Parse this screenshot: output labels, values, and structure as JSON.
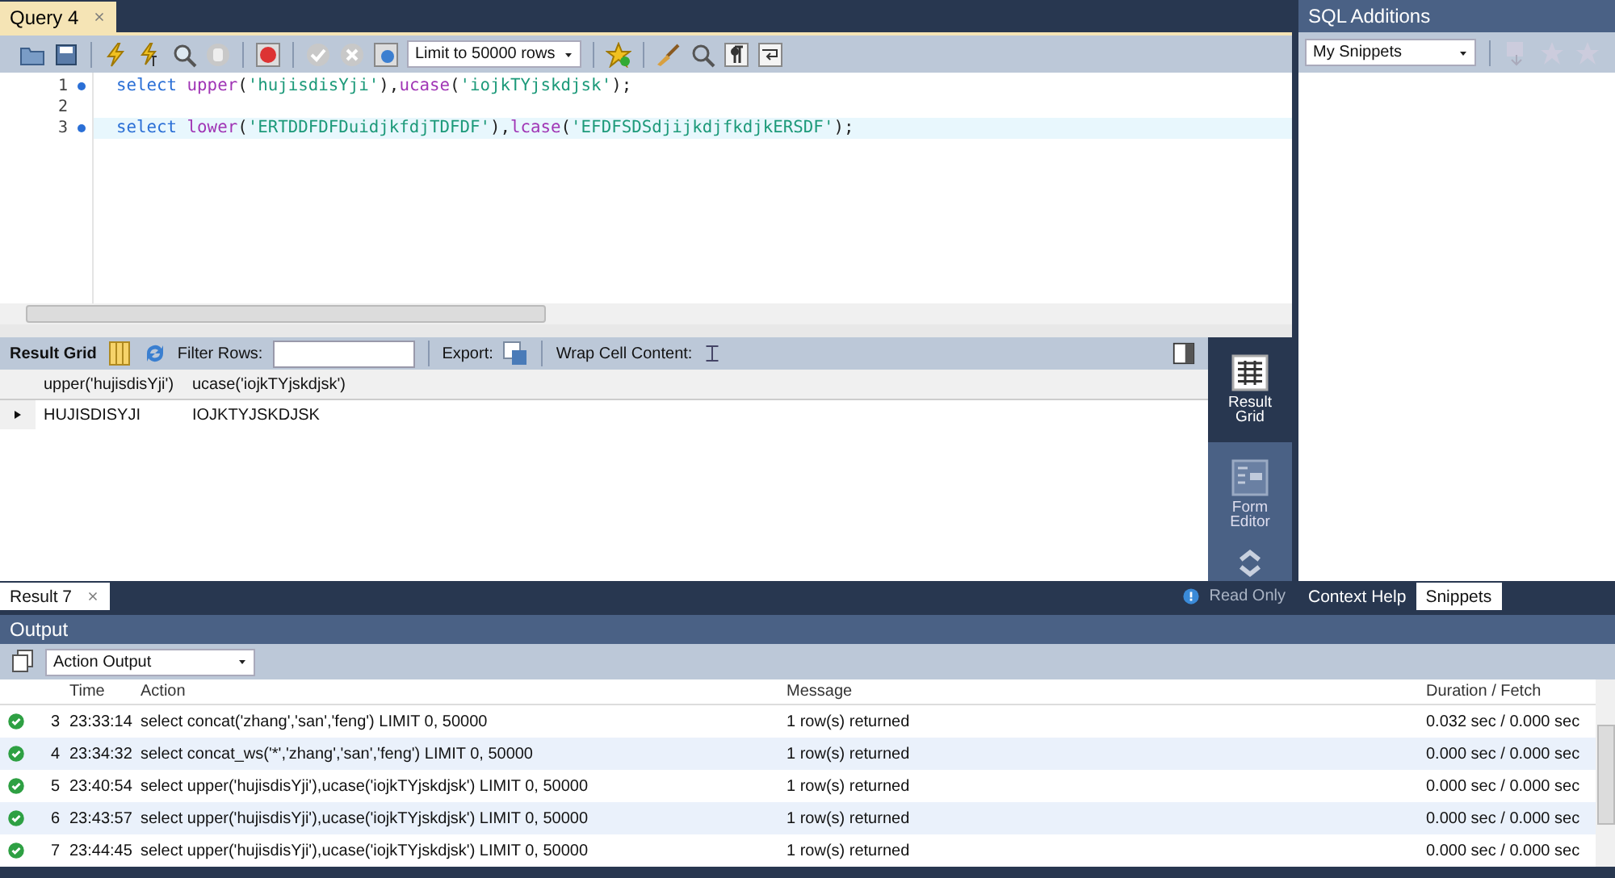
{
  "query_tab": {
    "label": "Query 4",
    "selected": true
  },
  "toolbar": {
    "limit": "Limit to 50000 rows"
  },
  "editor": {
    "lines": [
      {
        "number": "1",
        "marker": true,
        "current": false,
        "tokens": [
          {
            "kind": "keyword",
            "text": "select "
          },
          {
            "kind": "function",
            "text": "upper"
          },
          {
            "kind": "plain",
            "text": "("
          },
          {
            "kind": "string",
            "text": "'hujisdisYji'"
          },
          {
            "kind": "plain",
            "text": "),"
          },
          {
            "kind": "function",
            "text": "ucase"
          },
          {
            "kind": "plain",
            "text": "("
          },
          {
            "kind": "string",
            "text": "'iojkTYjskdjsk'"
          },
          {
            "kind": "plain",
            "text": ");"
          }
        ]
      },
      {
        "number": "2",
        "marker": false,
        "current": false
      },
      {
        "number": "3",
        "marker": true,
        "current": true,
        "tokens": [
          {
            "kind": "keyword",
            "text": "select "
          },
          {
            "kind": "function",
            "text": "lower"
          },
          {
            "kind": "plain",
            "text": "("
          },
          {
            "kind": "string",
            "text": "'ERTDDFDFDuidjkfdjTDFDF'"
          },
          {
            "kind": "plain",
            "text": "),"
          },
          {
            "kind": "function",
            "text": "lcase"
          },
          {
            "kind": "plain",
            "text": "("
          },
          {
            "kind": "string",
            "text": "'EFDFSDSdjijkdjfkdjkERSDF'"
          },
          {
            "kind": "plain",
            "text": ");"
          }
        ]
      }
    ]
  },
  "result_toolbar": {
    "result_grid": "Result Grid",
    "filter_label": "Filter Rows:",
    "export_label": "Export:",
    "wrap_label": "Wrap Cell Content:"
  },
  "grid": {
    "columns": [
      "upper('hujisdisYji')",
      "ucase('iojkTYjskdjsk')"
    ],
    "rows": [
      {
        "current": true,
        "cells": [
          "HUJISDISYJI",
          "IOJKTYJSKDJSK"
        ]
      }
    ]
  },
  "side_panel": [
    {
      "label": "Result Grid",
      "kind": "grid",
      "selected": true
    },
    {
      "label": "Form Editor",
      "kind": "form",
      "selected": false
    }
  ],
  "result_tabs": [
    {
      "label": "Result 7",
      "selected": true
    }
  ],
  "status": {
    "read_only": "Read Only"
  },
  "additions": {
    "title": "SQL Additions",
    "snippets_select": "My Snippets",
    "tabs": [
      {
        "label": "Context Help",
        "selected": false
      },
      {
        "label": "Snippets",
        "selected": true
      }
    ]
  },
  "output": {
    "title": "Output",
    "select": "Action Output",
    "columns": [
      "Time",
      "Action",
      "Message",
      "Duration / Fetch"
    ],
    "rows": [
      {
        "index": "3",
        "time": "23:33:14",
        "action": "select concat('zhang','san','feng') LIMIT 0, 50000",
        "message": "1 row(s) returned",
        "duration": "0.032 sec / 0.000 sec"
      },
      {
        "index": "4",
        "time": "23:34:32",
        "action": "select concat_ws('*','zhang','san','feng') LIMIT 0, 50000",
        "message": "1 row(s) returned",
        "duration": "0.000 sec / 0.000 sec"
      },
      {
        "index": "5",
        "time": "23:40:54",
        "action": "select upper('hujisdisYji'),ucase('iojkTYjskdjsk') LIMIT 0, 50000",
        "message": "1 row(s) returned",
        "duration": "0.000 sec / 0.000 sec"
      },
      {
        "index": "6",
        "time": "23:43:57",
        "action": "select upper('hujisdisYji'),ucase('iojkTYjskdjsk') LIMIT 0, 50000",
        "message": "1 row(s) returned",
        "duration": "0.000 sec / 0.000 sec"
      },
      {
        "index": "7",
        "time": "23:44:45",
        "action": "select upper('hujisdisYji'),ucase('iojkTYjskdjsk') LIMIT 0, 50000",
        "message": "1 row(s) returned",
        "duration": "0.000 sec / 0.000 sec"
      }
    ]
  }
}
